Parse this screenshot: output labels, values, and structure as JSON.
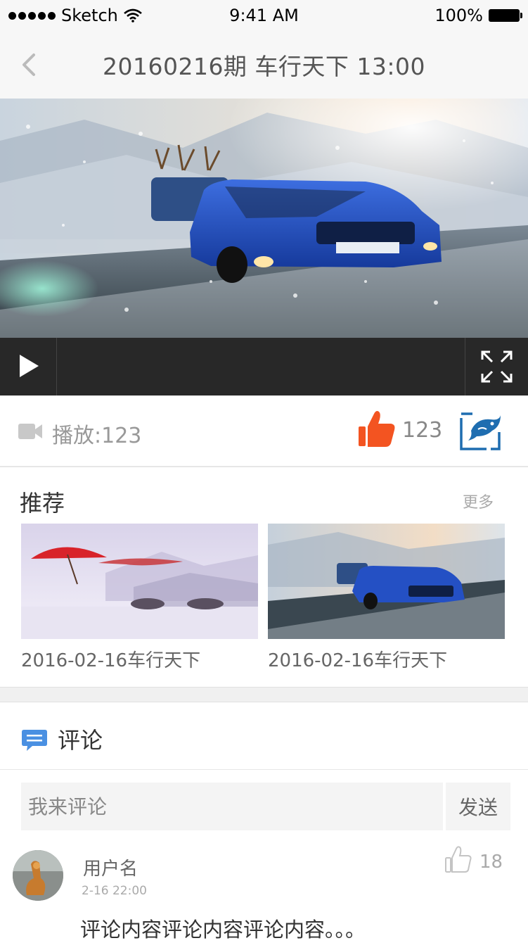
{
  "status_bar": {
    "carrier": "Sketch",
    "time": "9:41 AM",
    "battery": "100%"
  },
  "nav": {
    "title": "20160216期 车行天下 13:00"
  },
  "stats": {
    "plays_label": "播放:",
    "plays_count": "123",
    "likes_count": "123"
  },
  "recommend": {
    "title": "推荐",
    "more": "更多",
    "items": [
      {
        "caption": "2016-02-16车行天下"
      },
      {
        "caption": "2016-02-16车行天下"
      }
    ]
  },
  "comments": {
    "title": "评论",
    "input_placeholder": "我来评论",
    "send_label": "发送",
    "items": [
      {
        "username": "用户名",
        "time": "2-16 22:00",
        "likes": "18",
        "text": "评论内容评论内容评论内容。。。"
      }
    ]
  },
  "colors": {
    "like_accent": "#f35421",
    "share_accent": "#1e6db0",
    "comment_icon": "#4a90e2"
  }
}
